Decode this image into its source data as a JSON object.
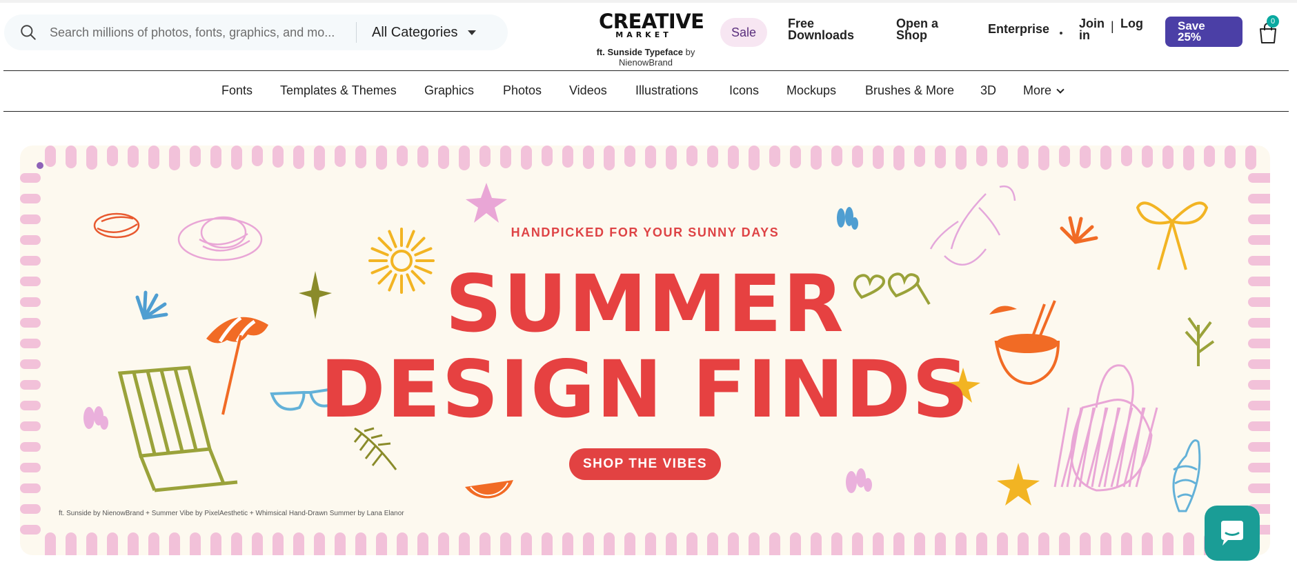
{
  "header": {
    "search": {
      "placeholder": "Search millions of photos, fonts, graphics, and mo...",
      "value": ""
    },
    "category": {
      "selected": "All Categories"
    },
    "logo": {
      "main": "CREATIVE",
      "sub": "MARKET"
    },
    "featured": {
      "font": "ft. Sunside Typeface",
      "by": "by",
      "author": "NienowBrand"
    },
    "links": {
      "sale": "Sale",
      "free_downloads_1": "Free",
      "free_downloads_2": "Downloads",
      "open_shop_1": "Open a",
      "open_shop_2": "Shop",
      "enterprise": "Enterprise",
      "join_1": "Join",
      "join_2": "in",
      "separator": "|",
      "login": "Log"
    },
    "save": {
      "line1": "Save",
      "line2": "25%"
    },
    "cart": {
      "count": "0"
    }
  },
  "nav": {
    "items": [
      "Fonts",
      "Templates & Themes",
      "Graphics",
      "Photos",
      "Videos",
      "Illustrations",
      "Icons",
      "Mockups",
      "Brushes & More",
      "3D",
      "More"
    ]
  },
  "hero": {
    "eyebrow": "HANDPICKED FOR YOUR SUNNY DAYS",
    "headline_1": "SUMMER",
    "headline_2": "DESIGN FINDS",
    "cta": "SHOP THE VIBES",
    "credit": "ft. Sunside by NienowBrand + Summer Vibe by PixelAesthetic + Whimsical Hand-Drawn Summer by Lana Elanor"
  },
  "colors": {
    "accent_red": "#e64141",
    "save_purple": "#4b3fa6",
    "chat_teal": "#1a9d96",
    "sale_pink": "#f7e6f2",
    "banner_bg": "#fdf9ef",
    "border_pink": "#f1bcd7"
  },
  "icons": [
    "search-icon",
    "chevron-down-icon",
    "cart-icon",
    "chat-icon"
  ]
}
